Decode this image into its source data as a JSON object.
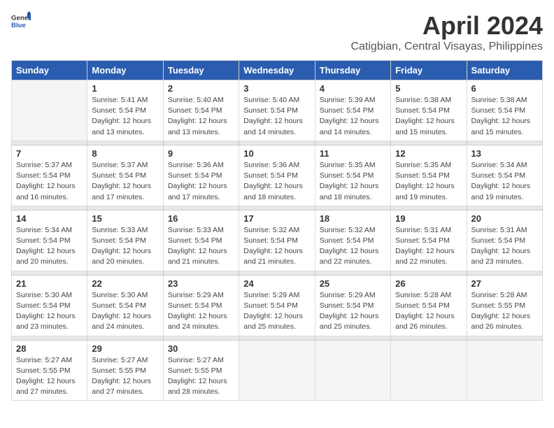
{
  "header": {
    "logo_general": "General",
    "logo_blue": "Blue",
    "month_year": "April 2024",
    "location": "Catigbian, Central Visayas, Philippines"
  },
  "weekdays": [
    "Sunday",
    "Monday",
    "Tuesday",
    "Wednesday",
    "Thursday",
    "Friday",
    "Saturday"
  ],
  "weeks": [
    [
      {
        "day": "",
        "empty": true
      },
      {
        "day": "1",
        "sunrise": "Sunrise: 5:41 AM",
        "sunset": "Sunset: 5:54 PM",
        "daylight": "Daylight: 12 hours and 13 minutes."
      },
      {
        "day": "2",
        "sunrise": "Sunrise: 5:40 AM",
        "sunset": "Sunset: 5:54 PM",
        "daylight": "Daylight: 12 hours and 13 minutes."
      },
      {
        "day": "3",
        "sunrise": "Sunrise: 5:40 AM",
        "sunset": "Sunset: 5:54 PM",
        "daylight": "Daylight: 12 hours and 14 minutes."
      },
      {
        "day": "4",
        "sunrise": "Sunrise: 5:39 AM",
        "sunset": "Sunset: 5:54 PM",
        "daylight": "Daylight: 12 hours and 14 minutes."
      },
      {
        "day": "5",
        "sunrise": "Sunrise: 5:38 AM",
        "sunset": "Sunset: 5:54 PM",
        "daylight": "Daylight: 12 hours and 15 minutes."
      },
      {
        "day": "6",
        "sunrise": "Sunrise: 5:38 AM",
        "sunset": "Sunset: 5:54 PM",
        "daylight": "Daylight: 12 hours and 15 minutes."
      }
    ],
    [
      {
        "day": "7",
        "sunrise": "Sunrise: 5:37 AM",
        "sunset": "Sunset: 5:54 PM",
        "daylight": "Daylight: 12 hours and 16 minutes."
      },
      {
        "day": "8",
        "sunrise": "Sunrise: 5:37 AM",
        "sunset": "Sunset: 5:54 PM",
        "daylight": "Daylight: 12 hours and 17 minutes."
      },
      {
        "day": "9",
        "sunrise": "Sunrise: 5:36 AM",
        "sunset": "Sunset: 5:54 PM",
        "daylight": "Daylight: 12 hours and 17 minutes."
      },
      {
        "day": "10",
        "sunrise": "Sunrise: 5:36 AM",
        "sunset": "Sunset: 5:54 PM",
        "daylight": "Daylight: 12 hours and 18 minutes."
      },
      {
        "day": "11",
        "sunrise": "Sunrise: 5:35 AM",
        "sunset": "Sunset: 5:54 PM",
        "daylight": "Daylight: 12 hours and 18 minutes."
      },
      {
        "day": "12",
        "sunrise": "Sunrise: 5:35 AM",
        "sunset": "Sunset: 5:54 PM",
        "daylight": "Daylight: 12 hours and 19 minutes."
      },
      {
        "day": "13",
        "sunrise": "Sunrise: 5:34 AM",
        "sunset": "Sunset: 5:54 PM",
        "daylight": "Daylight: 12 hours and 19 minutes."
      }
    ],
    [
      {
        "day": "14",
        "sunrise": "Sunrise: 5:34 AM",
        "sunset": "Sunset: 5:54 PM",
        "daylight": "Daylight: 12 hours and 20 minutes."
      },
      {
        "day": "15",
        "sunrise": "Sunrise: 5:33 AM",
        "sunset": "Sunset: 5:54 PM",
        "daylight": "Daylight: 12 hours and 20 minutes."
      },
      {
        "day": "16",
        "sunrise": "Sunrise: 5:33 AM",
        "sunset": "Sunset: 5:54 PM",
        "daylight": "Daylight: 12 hours and 21 minutes."
      },
      {
        "day": "17",
        "sunrise": "Sunrise: 5:32 AM",
        "sunset": "Sunset: 5:54 PM",
        "daylight": "Daylight: 12 hours and 21 minutes."
      },
      {
        "day": "18",
        "sunrise": "Sunrise: 5:32 AM",
        "sunset": "Sunset: 5:54 PM",
        "daylight": "Daylight: 12 hours and 22 minutes."
      },
      {
        "day": "19",
        "sunrise": "Sunrise: 5:31 AM",
        "sunset": "Sunset: 5:54 PM",
        "daylight": "Daylight: 12 hours and 22 minutes."
      },
      {
        "day": "20",
        "sunrise": "Sunrise: 5:31 AM",
        "sunset": "Sunset: 5:54 PM",
        "daylight": "Daylight: 12 hours and 23 minutes."
      }
    ],
    [
      {
        "day": "21",
        "sunrise": "Sunrise: 5:30 AM",
        "sunset": "Sunset: 5:54 PM",
        "daylight": "Daylight: 12 hours and 23 minutes."
      },
      {
        "day": "22",
        "sunrise": "Sunrise: 5:30 AM",
        "sunset": "Sunset: 5:54 PM",
        "daylight": "Daylight: 12 hours and 24 minutes."
      },
      {
        "day": "23",
        "sunrise": "Sunrise: 5:29 AM",
        "sunset": "Sunset: 5:54 PM",
        "daylight": "Daylight: 12 hours and 24 minutes."
      },
      {
        "day": "24",
        "sunrise": "Sunrise: 5:29 AM",
        "sunset": "Sunset: 5:54 PM",
        "daylight": "Daylight: 12 hours and 25 minutes."
      },
      {
        "day": "25",
        "sunrise": "Sunrise: 5:29 AM",
        "sunset": "Sunset: 5:54 PM",
        "daylight": "Daylight: 12 hours and 25 minutes."
      },
      {
        "day": "26",
        "sunrise": "Sunrise: 5:28 AM",
        "sunset": "Sunset: 5:54 PM",
        "daylight": "Daylight: 12 hours and 26 minutes."
      },
      {
        "day": "27",
        "sunrise": "Sunrise: 5:28 AM",
        "sunset": "Sunset: 5:55 PM",
        "daylight": "Daylight: 12 hours and 26 minutes."
      }
    ],
    [
      {
        "day": "28",
        "sunrise": "Sunrise: 5:27 AM",
        "sunset": "Sunset: 5:55 PM",
        "daylight": "Daylight: 12 hours and 27 minutes."
      },
      {
        "day": "29",
        "sunrise": "Sunrise: 5:27 AM",
        "sunset": "Sunset: 5:55 PM",
        "daylight": "Daylight: 12 hours and 27 minutes."
      },
      {
        "day": "30",
        "sunrise": "Sunrise: 5:27 AM",
        "sunset": "Sunset: 5:55 PM",
        "daylight": "Daylight: 12 hours and 28 minutes."
      },
      {
        "day": "",
        "empty": true
      },
      {
        "day": "",
        "empty": true
      },
      {
        "day": "",
        "empty": true
      },
      {
        "day": "",
        "empty": true
      }
    ]
  ]
}
